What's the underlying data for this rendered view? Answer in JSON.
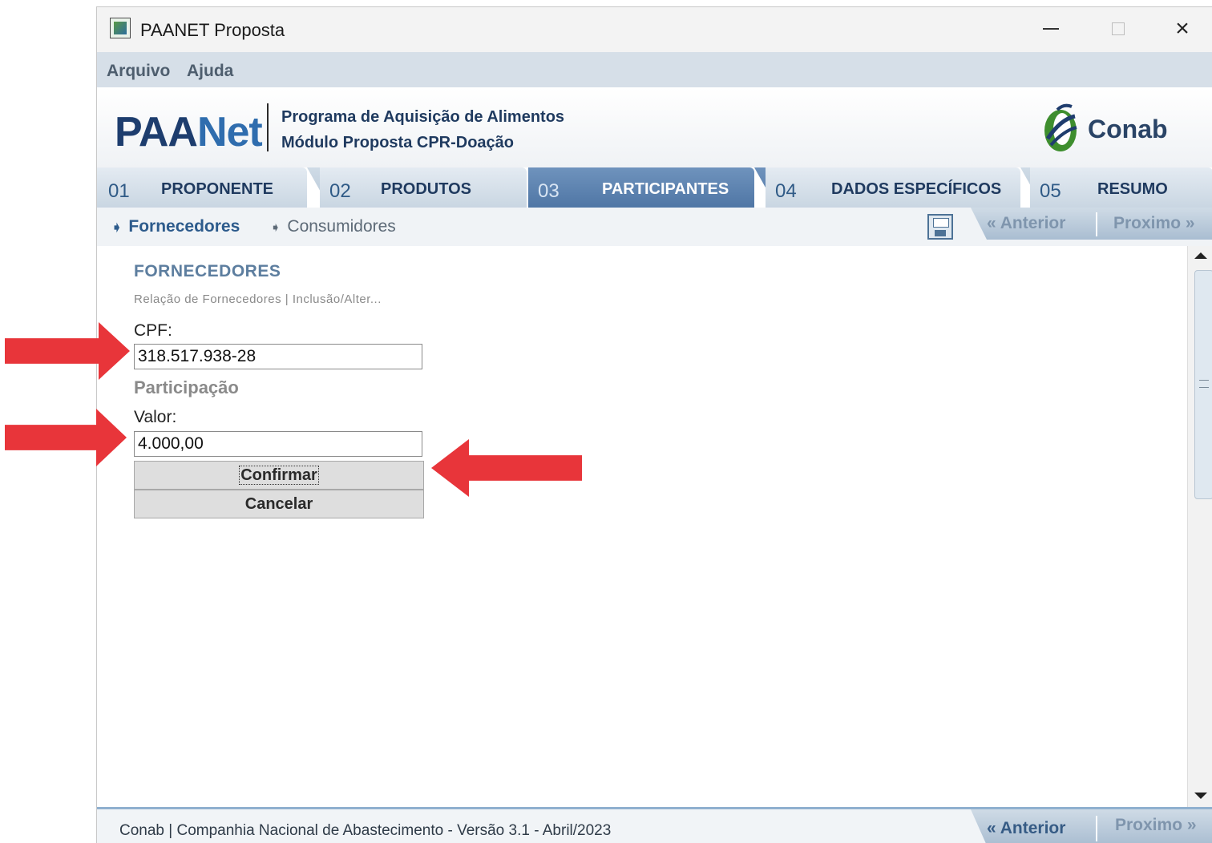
{
  "window": {
    "title": "PAANET Proposta"
  },
  "menu": [
    "Arquivo",
    "Ajuda"
  ],
  "banner": {
    "logo_left": "PAA",
    "logo_right": "Net",
    "line1": "Programa de Aquisição de Alimentos",
    "line2": "Módulo Proposta CPR-Doação",
    "brand": "Conab"
  },
  "tabs": [
    {
      "num": "01",
      "label": "PROPONENTE"
    },
    {
      "num": "02",
      "label": "PRODUTOS"
    },
    {
      "num": "03",
      "label": "PARTICIPANTES"
    },
    {
      "num": "04",
      "label": "DADOS ESPECÍFICOS"
    },
    {
      "num": "05",
      "label": "RESUMO"
    }
  ],
  "active_tab": "PARTICIPANTES",
  "subnav": {
    "items": [
      "Fornecedores",
      "Consumidores"
    ],
    "active": "Fornecedores",
    "prev": "Anterior",
    "next": "Proximo",
    "prev_glyph": "«",
    "next_glyph": "»",
    "arrow_glyph": "➧"
  },
  "form": {
    "section_title": "FORNECEDORES",
    "breadcrumb": "Relação de Fornecedores | Inclusão/Alter...",
    "cpf_label": "CPF:",
    "cpf_value": "318.517.938-28",
    "group_title": "Participação",
    "valor_label": "Valor:",
    "valor_value": "4.000,00",
    "confirm_label": "Confirmar",
    "cancel_label": "Cancelar"
  },
  "footer": {
    "text": "Conab | Companhia Nacional de Abastecimento - Versão 3.1 - Abril/2023",
    "prev": "Anterior",
    "next": "Proximo"
  },
  "colors": {
    "accent": "#4f76a5",
    "annotation_arrow": "#e8353a"
  }
}
